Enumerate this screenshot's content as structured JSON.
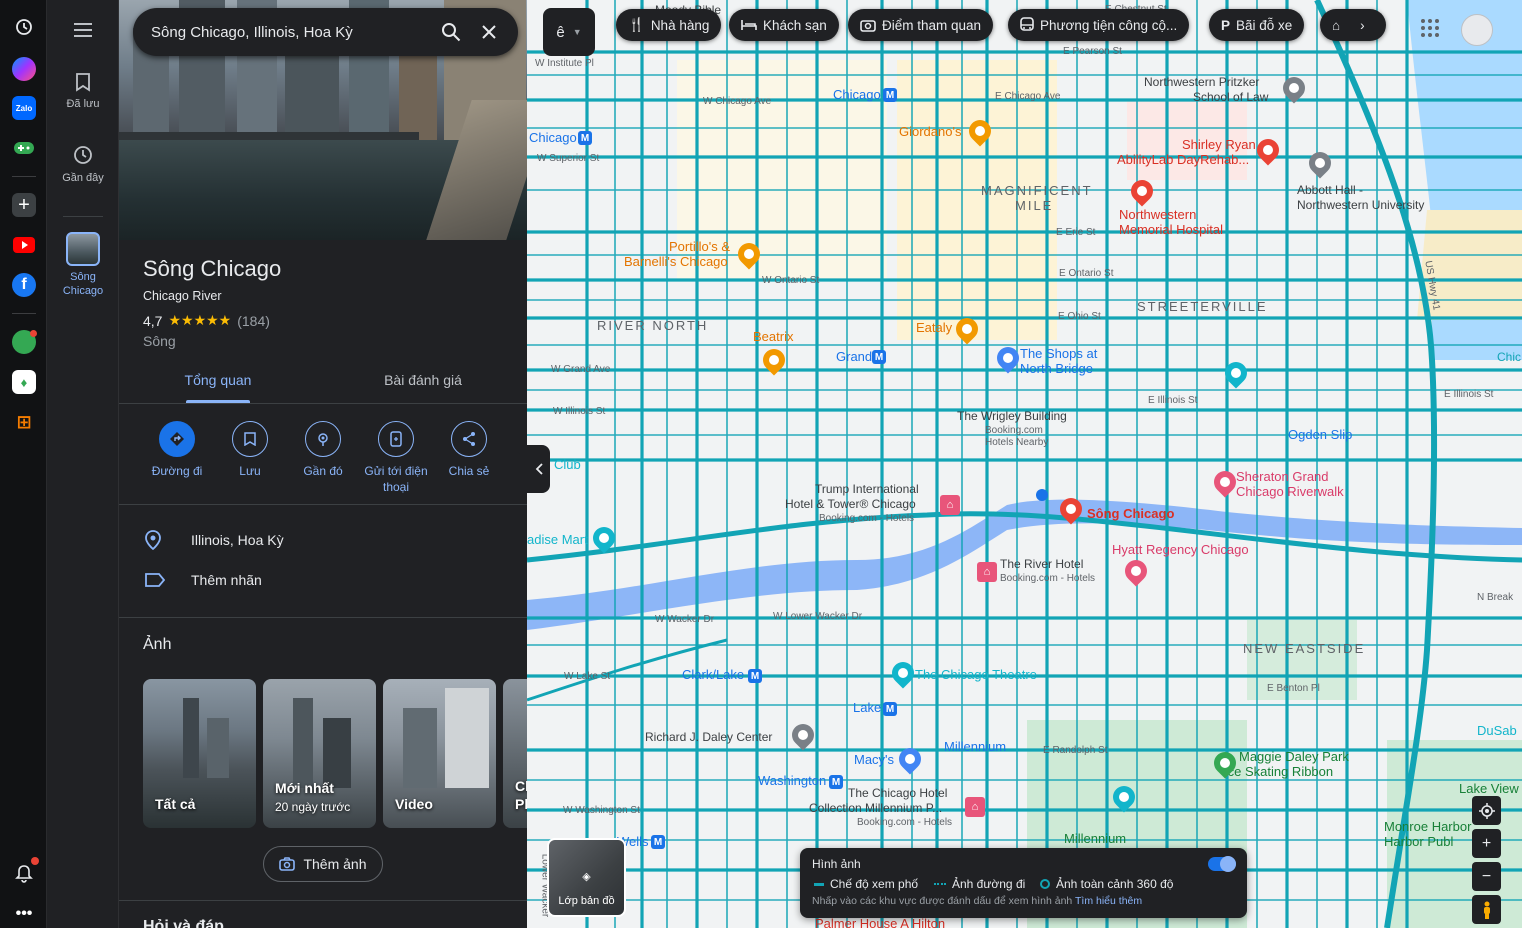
{
  "search": {
    "value": "Sông Chicago, Illinois, Hoa Kỳ"
  },
  "maps_rail": {
    "saved_label": "Đã lưu",
    "recent_label": "Gần đây",
    "current_place_line1": "Sông",
    "current_place_line2": "Chicago"
  },
  "place": {
    "title": "Sông Chicago",
    "subtitle": "Chicago River",
    "rating": "4,7",
    "stars": "★★★★★",
    "review_count": "(184)",
    "type": "Sông"
  },
  "tabs": {
    "overview": "Tổng quan",
    "reviews": "Bài đánh giá"
  },
  "actions": {
    "directions": "Đường đi",
    "save": "Lưu",
    "nearby": "Gần đó",
    "send_line1": "Gửi tới điện",
    "send_line2": "thoại",
    "share": "Chia sẻ"
  },
  "info": {
    "address": "Illinois, Hoa Kỳ",
    "label": "Thêm nhãn"
  },
  "photos": {
    "title": "Ảnh",
    "all": "Tất cả",
    "latest": "Mới nhất",
    "latest_sub": "20 ngày trước",
    "video": "Video",
    "partial_line1": "Ch",
    "partial_line2": "Ph",
    "add": "Thêm ảnh"
  },
  "qa_title": "Hỏi và đáp",
  "map": {
    "lang": "ê",
    "chips": {
      "restaurants": "Nhà hàng",
      "hotels": "Khách sạn",
      "attractions": "Điểm tham quan",
      "transit": "Phương tiện công cộ...",
      "parking": "Bãi đỗ xe"
    },
    "layers_label": "Lớp bản đồ",
    "imagery": {
      "title": "Hình ảnh",
      "street_view": "Chế độ xem phố",
      "road_imagery": "Ảnh đường đi",
      "panorama": "Ảnh toàn cảnh 360 độ",
      "hint": "Nhấp vào các khu vực được đánh dấu để xem hình ảnh",
      "learn_more": "Tìm hiểu thêm"
    },
    "labels": {
      "moody_bible": "Moody Bible",
      "chestnut": "E Chestnut St",
      "pearson": "E Pearson St",
      "w_institute": "W Institute Pl",
      "w_chicago_ave": "W Chicago Ave",
      "e_chicago_ave": "E Chicago Ave",
      "chicago_m1": "Chicago",
      "chicago_m2": "Chicago",
      "w_superior": "W Superior St",
      "nw_pritzker_1": "Northwestern Pritzker",
      "nw_pritzker_2": "School of Law",
      "shirley_1": "Shirley Ryan",
      "shirley_2": "AbilityLab DayRehab...",
      "giordanos": "Giordano's",
      "magnificent": "MAGNIFICENT",
      "mile": "MILE",
      "abbott_1": "Abbott Hall -",
      "abbott_2": "Northwestern University",
      "nw_mem_1": "Northwestern",
      "nw_mem_2": "Memorial Hospital",
      "e_erie": "E Erie St",
      "portillos_1": "Portillo's &",
      "portillos_2": "Barnelli's Chicago",
      "w_ontario": "W Ontario St",
      "e_ontario": "E Ontario St",
      "streeterville": "STREETERVILLE",
      "river_north": "RIVER NORTH",
      "eataly": "Eataly",
      "e_ohio": "E Ohio St",
      "beatrix": "Beatrix",
      "grand_m": "Grand",
      "shops_1": "The Shops at",
      "shops_2": "North Bridge",
      "w_grand": "W Grand Ave",
      "w_illinois": "W Illinois St",
      "e_illinois": "E Illinois St",
      "e_illinois2": "E Illinois St",
      "wrigley": "The Wrigley Building",
      "wrigley_b": "Booking.com",
      "wrigley_h": "Hotels Nearby",
      "ogden": "Ogden Slip",
      "club": "Club",
      "trump_1": "Trump International",
      "trump_2": "Hotel & Tower® Chicago",
      "trump_3": "Booking.com - Hotels",
      "sheraton_1": "Sheraton Grand",
      "sheraton_2": "Chicago Riverwalk",
      "song_chicago": "Sông Chicago",
      "hyatt": "Hyatt Regency Chicago",
      "paradise": "adise Mart",
      "river_hotel": "The River Hotel",
      "river_hotel_b": "Booking.com - Hotels",
      "w_wacker": "W Wacker Dr",
      "w_lower_wacker": "W Lower Wacker Dr",
      "new_eastside": "NEW EASTSIDE",
      "e_benton": "E Benton Pl",
      "w_lake": "W Lake St",
      "clark_lake": "Clark/Lake",
      "chicago_theatre": "The Chicago Theatre",
      "lake_m": "Lake",
      "daley": "Richard J. Daley Center",
      "millennium_m": "Millennium",
      "e_randolph": "E Randolph St",
      "maggie_1": "Maggie Daley Park",
      "maggie_2": "Ice Skating Ribbon",
      "macys": "Macy's",
      "washington_m": "Washington",
      "chi_hotel_1": "The Chicago Hotel",
      "chi_hotel_2": "Collection Millennium P...",
      "chi_hotel_3": "Booking.com - Hotels",
      "w_washington": "W Washington St",
      "wells_m": "Wells",
      "millennium_park": "Millennium",
      "monroe_1": "Monroe Harbor",
      "monroe_2": "Harbor Publ",
      "lake_view": "Lake View",
      "dusab": "DuSab",
      "palmer": "Palmer House A Hilton",
      "us41": "US Hwy 41",
      "n_breakwater": "N Break",
      "chic_edge": "Chic",
      "lower_wacker_v": "Lower Wacker"
    }
  }
}
